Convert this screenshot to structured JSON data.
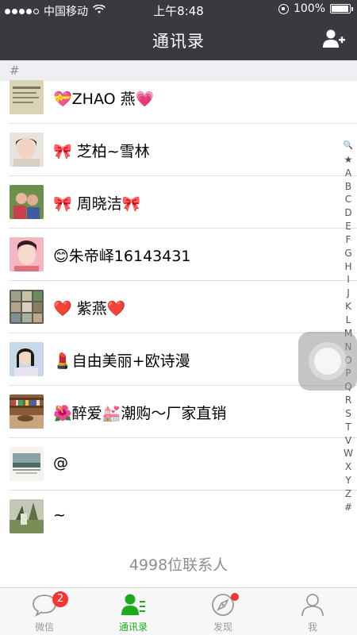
{
  "status": {
    "carrier": "中国移动",
    "time": "上午8:48",
    "battery": "100%",
    "battery_level": 1.0
  },
  "nav": {
    "title": "通讯录"
  },
  "section": {
    "letter": "#"
  },
  "contacts": [
    {
      "name": "💝ZHAO 燕💗"
    },
    {
      "name": "🎀 芝柏~雪林"
    },
    {
      "name": "🎀 周晓洁🎀"
    },
    {
      "name": "😊朱帝峄16143431"
    },
    {
      "name": "❤️ 紫燕❤️"
    },
    {
      "name": "💄自由美丽+欧诗漫"
    },
    {
      "name": "🌺醉爱💒潮购～厂家直销"
    },
    {
      "name": "@"
    },
    {
      "name": "~"
    }
  ],
  "index_letters": [
    "🔍",
    "★",
    "A",
    "B",
    "C",
    "D",
    "E",
    "F",
    "G",
    "H",
    "I",
    "J",
    "K",
    "L",
    "M",
    "N",
    "O",
    "P",
    "Q",
    "R",
    "S",
    "T",
    "V",
    "W",
    "X",
    "Y",
    "Z",
    "#"
  ],
  "footer": {
    "count_text": "4998位联系人"
  },
  "tabs": [
    {
      "label": "微信",
      "icon": "chat-bubble-icon",
      "badge": "2"
    },
    {
      "label": "通讯录",
      "icon": "contacts-icon",
      "active": true
    },
    {
      "label": "发现",
      "icon": "compass-icon",
      "dot": true
    },
    {
      "label": "我",
      "icon": "person-icon"
    }
  ],
  "colors": {
    "accent": "#1aad19",
    "header": "#393a3f",
    "badge": "#f43530"
  }
}
